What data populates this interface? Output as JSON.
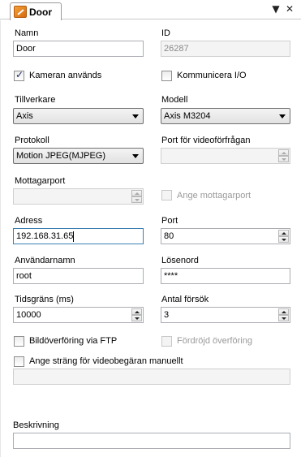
{
  "tab": {
    "title": "Door",
    "icon": "camera-door-icon"
  },
  "titlebar": {
    "dropdown_glyph": "▼",
    "close_glyph": "✕"
  },
  "form": {
    "name_label": "Namn",
    "name_value": "Door",
    "id_label": "ID",
    "id_value": "26287",
    "camera_used_label": "Kameran används",
    "camera_used_checked": true,
    "communicate_io_label": "Kommunicera I/O",
    "communicate_io_checked": false,
    "manufacturer_label": "Tillverkare",
    "manufacturer_value": "Axis",
    "model_label": "Modell",
    "model_value": "Axis M3204",
    "protocol_label": "Protokoll",
    "protocol_value": "Motion JPEG(MJPEG)",
    "video_port_label": "Port för videoförfrågan",
    "video_port_value": "",
    "receive_port_label": "Mottagarport",
    "receive_port_value": "",
    "specify_receive_port_label": "Ange mottagarport",
    "specify_receive_port_checked": false,
    "address_label": "Adress",
    "address_value": "192.168.31.65",
    "port_label": "Port",
    "port_value": "80",
    "username_label": "Användarnamn",
    "username_value": "root",
    "password_label": "Lösenord",
    "password_value": "****",
    "timeout_label": "Tidsgräns (ms)",
    "timeout_value": "10000",
    "attempts_label": "Antal försök",
    "attempts_value": "3",
    "ftp_label": "Bildöverföring via FTP",
    "ftp_checked": false,
    "delayed_transfer_label": "Fördröjd överföring",
    "delayed_transfer_checked": false,
    "manual_string_label": "Ange sträng för videobegäran manuellt",
    "manual_string_checked": false,
    "manual_string_value": "",
    "description_label": "Beskrivning",
    "description_value": ""
  }
}
